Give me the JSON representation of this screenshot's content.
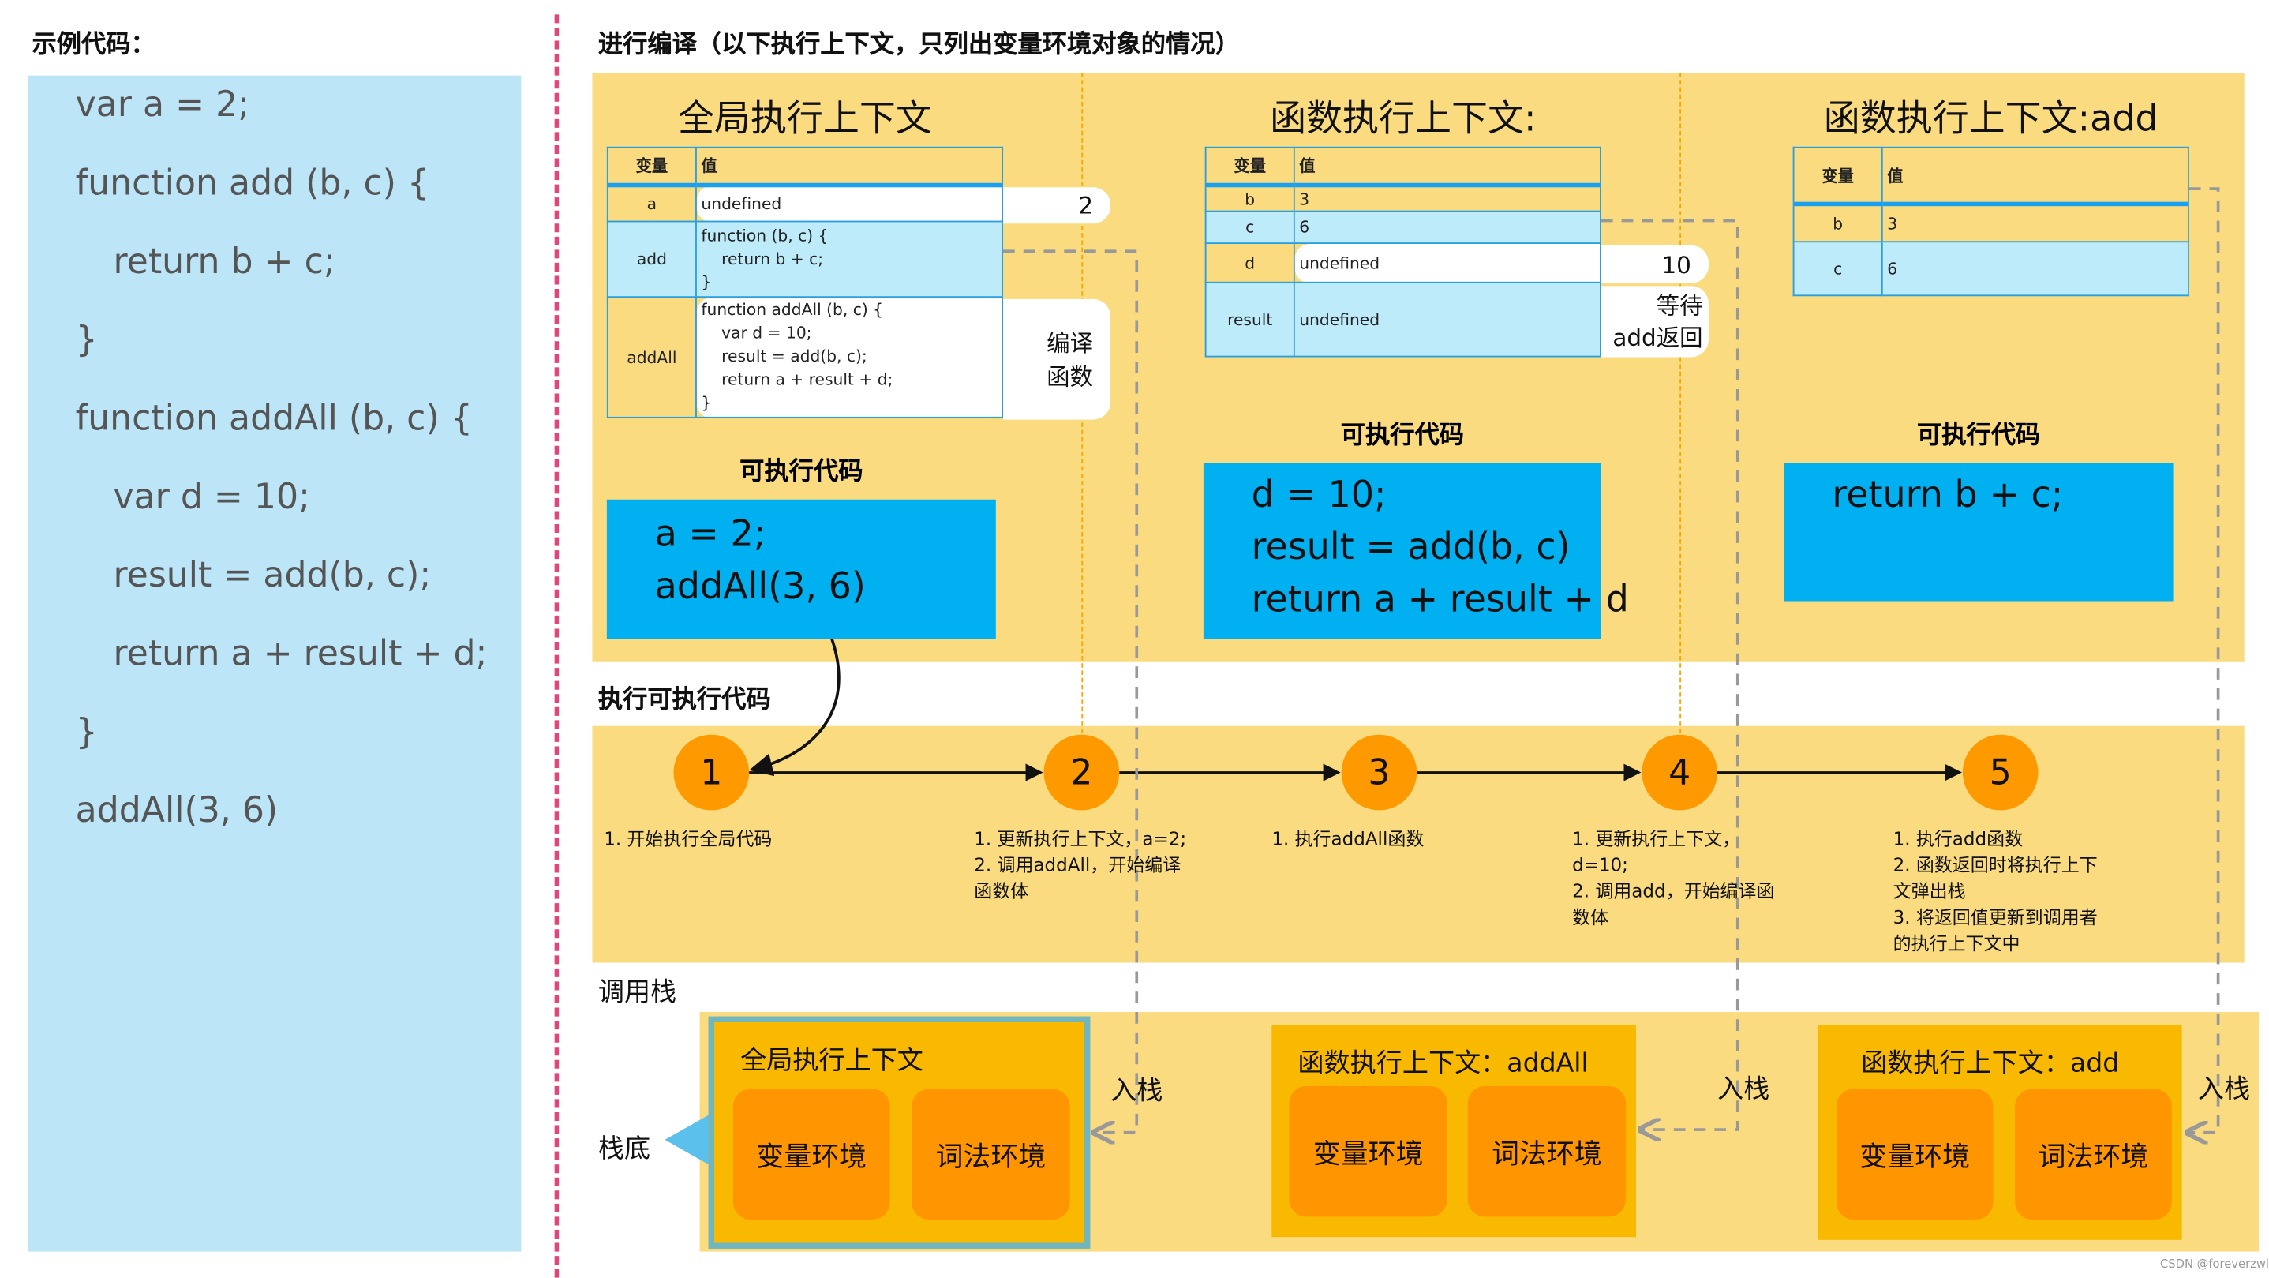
{
  "sample": {
    "title": "示例代码：",
    "lines": [
      "var a = 2;",
      "function add (b, c) {",
      "return b + c;",
      "}",
      "function addAll (b, c) {",
      "var d = 10;",
      "result = add(b, c);",
      "return a + result + d;",
      "}",
      "addAll(3, 6)"
    ]
  },
  "compile_title": "进行编译（以下执行上下文，只列出变量环境对象的情况）",
  "contexts": [
    {
      "title": "全局执行上下文",
      "header": [
        "变量",
        "值"
      ],
      "rows": [
        [
          "a",
          "undefined"
        ],
        [
          "add",
          "function (b, c) {\n    return b + c;\n}"
        ],
        [
          "addAll",
          "function addAll (b, c) {\n    var d = 10;\n    result = add(b, c);\n    return a + result + d;\n}"
        ]
      ],
      "notes": [
        "2",
        "编译\n函数"
      ],
      "exec_label": "可执行代码",
      "exec_code": "a = 2;\naddAll(3, 6)"
    },
    {
      "title": "函数执行上下文:",
      "header": [
        "变量",
        "值"
      ],
      "rows": [
        [
          "b",
          "3"
        ],
        [
          "c",
          "6"
        ],
        [
          "d",
          "undefined"
        ],
        [
          "result",
          "undefined"
        ]
      ],
      "notes": [
        "10",
        "等待\nadd返回"
      ],
      "exec_label": "可执行代码",
      "exec_code": "d = 10;\nresult = add(b, c)\nreturn a + result + d"
    },
    {
      "title": "函数执行上下文:add",
      "header": [
        "变量",
        "值"
      ],
      "rows": [
        [
          "b",
          "3"
        ],
        [
          "c",
          "6"
        ]
      ],
      "exec_label": "可执行代码",
      "exec_code": "return b + c;"
    }
  ],
  "execution": {
    "title": "执行可执行代码",
    "steps": [
      {
        "num": "1",
        "text": "1. 开始执行全局代码"
      },
      {
        "num": "2",
        "text": "1. 更新执行上下文，a=2;\n2. 调用addAll，开始编译\n函数体"
      },
      {
        "num": "3",
        "text": "1. 执行addAll函数"
      },
      {
        "num": "4",
        "text": "1. 更新执行上下文，\nd=10;\n2. 调用add，开始编译函\n数体"
      },
      {
        "num": "5",
        "text": "1. 执行add函数\n2. 函数返回时将执行上下\n文弹出栈\n3. 将返回值更新到调用者\n的执行上下文中"
      }
    ]
  },
  "callstack": {
    "title": "调用栈",
    "bottom_label": "栈底",
    "push_label": "入栈",
    "frames": [
      {
        "title": "全局执行上下文",
        "envs": [
          "变量环境",
          "词法环境"
        ]
      },
      {
        "title": "函数执行上下文：addAll",
        "envs": [
          "变量环境",
          "词法环境"
        ]
      },
      {
        "title": "函数执行上下文：add",
        "envs": [
          "变量环境",
          "词法环境"
        ]
      }
    ]
  },
  "watermark": "CSDN @foreverzwl",
  "colors": {
    "panel": "#BDE5F8",
    "yellow": "#FADB7F",
    "code_box": "#00B0F0",
    "step_circle": "#FF9900",
    "stack_frame": "#F8B900",
    "env_box": "#FF9500",
    "divider": "#E0457B"
  }
}
